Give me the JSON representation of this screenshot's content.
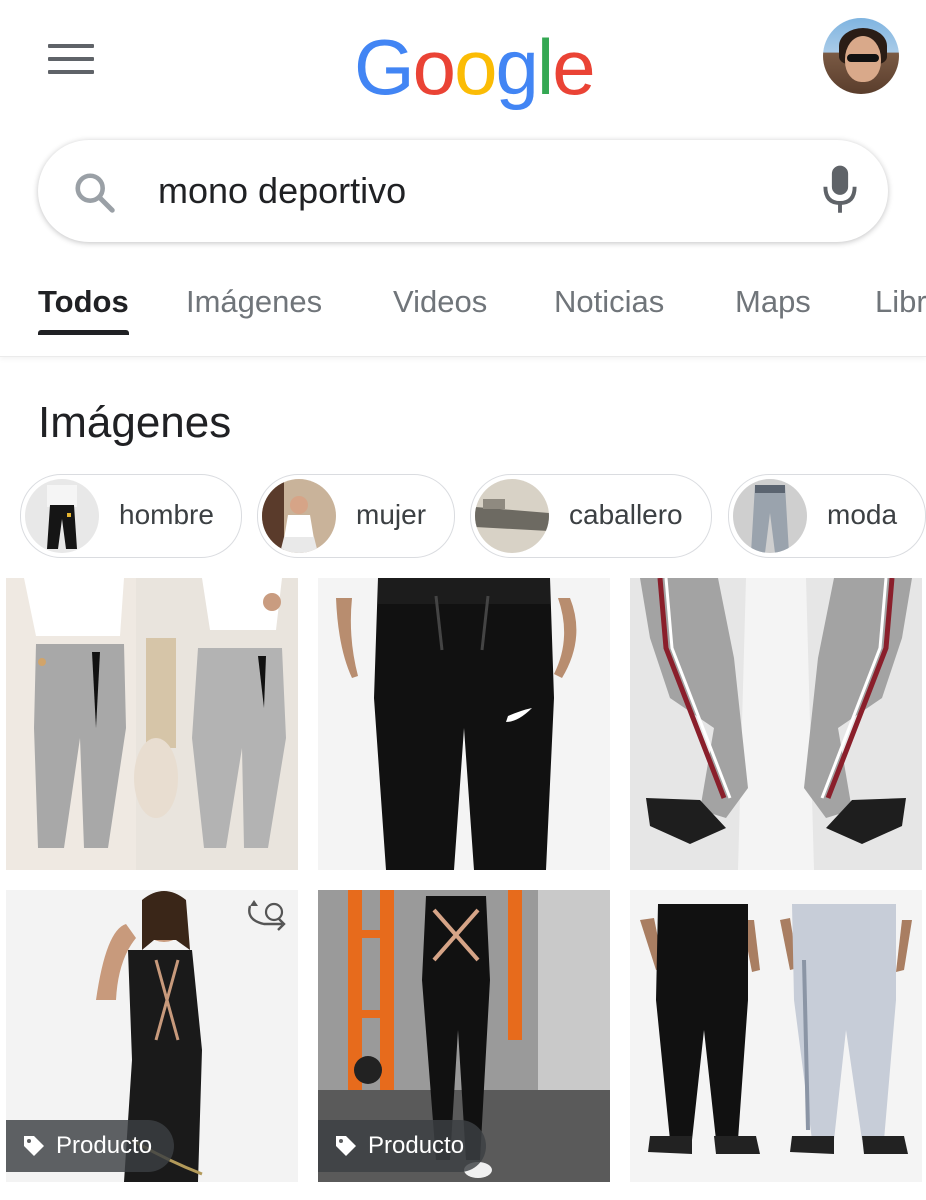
{
  "header": {
    "logo_letters": [
      "G",
      "o",
      "o",
      "g",
      "l",
      "e"
    ]
  },
  "search": {
    "query": "mono deportivo"
  },
  "tabs": [
    {
      "label": "Todos",
      "active": true
    },
    {
      "label": "Imágenes",
      "active": false
    },
    {
      "label": "Videos",
      "active": false
    },
    {
      "label": "Noticias",
      "active": false
    },
    {
      "label": "Maps",
      "active": false
    },
    {
      "label": "Libros",
      "active": false
    }
  ],
  "images_section": {
    "title": "Imágenes",
    "chips": [
      {
        "label": "hombre"
      },
      {
        "label": "mujer"
      },
      {
        "label": "caballero"
      },
      {
        "label": "moda"
      }
    ],
    "results": [
      {
        "tag": ""
      },
      {
        "tag": ""
      },
      {
        "tag": ""
      },
      {
        "tag": "Producto"
      },
      {
        "tag": "Producto"
      },
      {
        "tag": ""
      }
    ]
  },
  "colors": {
    "google_blue": "#4285F4",
    "google_red": "#EA4335",
    "google_yellow": "#FBBC05",
    "google_green": "#34A853",
    "icon_gray": "#5f6368"
  },
  "icons": [
    "menu-icon",
    "search-icon",
    "mic-icon",
    "tag-icon",
    "rotate-360-icon"
  ]
}
